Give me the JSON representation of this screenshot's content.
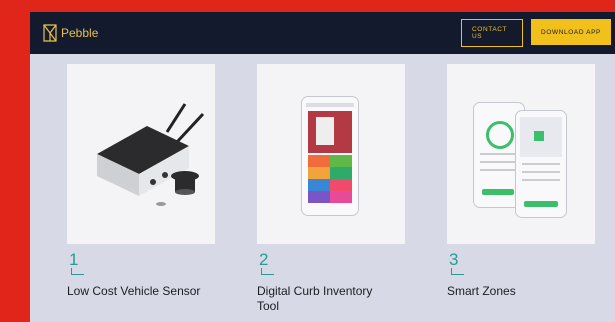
{
  "brand": {
    "name": "Pebble",
    "logo_icon": "pebble-logo-icon",
    "accent": "#f2c01a"
  },
  "nav": {
    "contact_label": "CONTACT US",
    "download_label": "DOWNLOAD APP"
  },
  "cards": [
    {
      "number": "1",
      "title": "Low Cost Vehicle Sensor",
      "image_icon": "vehicle-sensor-image"
    },
    {
      "number": "2",
      "title": "Digital Curb Inventory Tool",
      "image_icon": "curb-inventory-phone-image"
    },
    {
      "number": "3",
      "title": "Smart Zones",
      "image_icon": "smart-zones-phones-image"
    }
  ],
  "colors": {
    "page_bg": "#d7d9e6",
    "nav_bg": "#141a2e",
    "number_color": "#2c9a92",
    "edge": "#e0251b"
  }
}
